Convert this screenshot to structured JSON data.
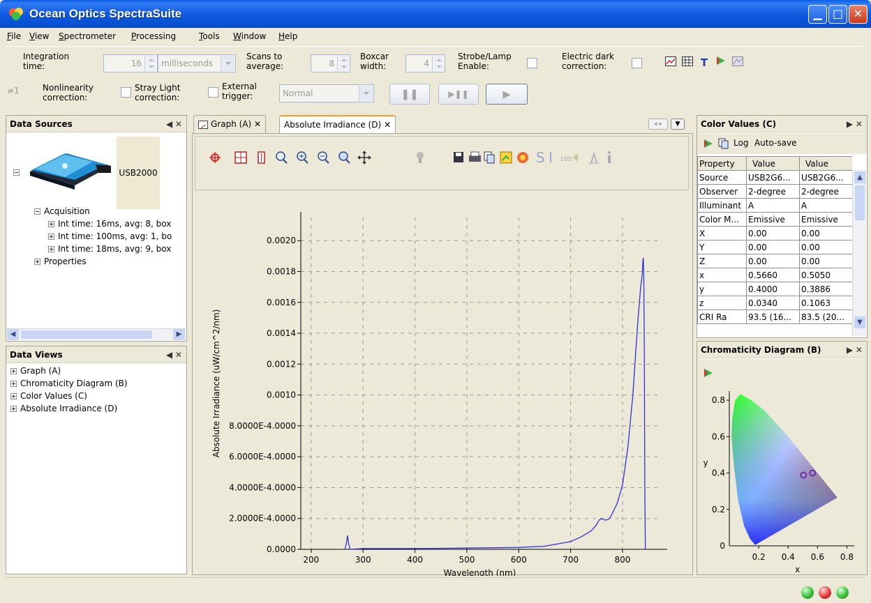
{
  "window": {
    "title": "Ocean Optics SpectraSuite"
  },
  "menu": [
    "File",
    "View",
    "Spectrometer",
    "Processing",
    "Tools",
    "Window",
    "Help"
  ],
  "toolbar": {
    "integration_time_label": "Integration time:",
    "integration_time_value": "16",
    "integration_unit": "milliseconds",
    "scans_label": "Scans to average:",
    "scans_value": "8",
    "boxcar_label": "Boxcar width:",
    "boxcar_value": "4",
    "strobe_label": "Strobe/Lamp Enable:",
    "dark_label": "Electric dark correction:",
    "nonlinearity_label": "Nonlinearity correction:",
    "stray_label": "Stray Light correction:",
    "trigger_label": "External trigger:",
    "trigger_value": "Normal",
    "neq_symbol": "≠1"
  },
  "data_sources": {
    "title": "Data Sources",
    "device": "USB2000",
    "acquisition_label": "Acquisition",
    "items": [
      "Int time: 16ms, avg: 8, box",
      "Int time: 100ms, avg: 1, bo",
      "Int time: 18ms, avg: 9, box"
    ],
    "properties_label": "Properties"
  },
  "data_views": {
    "title": "Data Views",
    "items": [
      "Graph (A)",
      "Chromaticity Diagram (B)",
      "Color Values (C)",
      "Absolute Irradiance (D)"
    ]
  },
  "tabs": [
    {
      "label": "Graph (A)",
      "active": false
    },
    {
      "label": "Absolute Irradiance (D)",
      "active": true
    }
  ],
  "chart_data": [
    {
      "type": "line",
      "title": "",
      "xlabel": "Wavelength (nm)",
      "ylabel": "Absolute Irradiance (uW/cm^2/nm)",
      "xlim": [
        180,
        870
      ],
      "ylim": [
        0,
        0.00215
      ],
      "xticks": [
        200,
        300,
        400,
        500,
        600,
        700,
        800
      ],
      "yticks": [
        0,
        0.0002,
        0.0004,
        0.0006,
        0.0008,
        0.001,
        0.0012,
        0.0014,
        0.0016,
        0.0018,
        0.002
      ],
      "ytick_labels": [
        "0.0000",
        "2.0000E-4.0000",
        "4.0000E-4.0000",
        "6.0000E-4.0000",
        "8.0000E-4.0000",
        "0.0010",
        "0.0012",
        "0.0014",
        "0.0016",
        "0.0018",
        "0.0020"
      ],
      "grid": true,
      "series": [
        {
          "color": "#3030d8",
          "x": [
            265,
            268,
            270,
            272,
            275,
            300,
            400,
            500,
            600,
            650,
            700,
            720,
            740,
            750,
            755,
            760,
            765,
            770,
            775,
            780,
            790,
            800,
            810,
            820,
            825,
            830,
            835,
            838,
            839,
            840,
            841,
            842,
            843,
            844
          ],
          "y": [
            0,
            4e-05,
            9e-05,
            4e-05,
            0,
            5e-06,
            5e-06,
            8e-06,
            1.2e-05,
            2e-05,
            5e-05,
            8e-05,
            0.00012,
            0.00016,
            0.00019,
            0.0002,
            0.00019,
            0.00019,
            0.0002,
            0.00023,
            0.0003,
            0.00042,
            0.00065,
            0.001,
            0.00125,
            0.0015,
            0.0017,
            0.00178,
            0.00186,
            0.00189,
            0.0018,
            0.0013,
            0.0004,
            0
          ]
        }
      ]
    },
    {
      "type": "scatter",
      "title": "",
      "xlabel": "x",
      "ylabel": "y",
      "xlim": [
        0,
        0.85
      ],
      "ylim": [
        0,
        0.85
      ],
      "xticks": [
        0.2,
        0.4,
        0.6,
        0.8
      ],
      "yticks": [
        0.2,
        0.4,
        0.6,
        0.8
      ],
      "series": [
        {
          "x": [
            0.566,
            0.505
          ],
          "y": [
            0.4,
            0.3886
          ]
        }
      ]
    }
  ],
  "color_values": {
    "title": "Color Values (C)",
    "log_label": "Log",
    "autosave_label": "Auto-save",
    "headers": [
      "Property",
      "Value",
      "Value"
    ],
    "rows": [
      [
        "Source",
        "USB2G6...",
        "USB2G6..."
      ],
      [
        "Observer",
        "2-degree",
        "2-degree"
      ],
      [
        "Illuminant",
        "A",
        "A"
      ],
      [
        "Color M...",
        "Emissive",
        "Emissive"
      ],
      [
        "X",
        "0.00",
        "0.00"
      ],
      [
        "Y",
        "0.00",
        "0.00"
      ],
      [
        "Z",
        "0.00",
        "0.00"
      ],
      [
        "x",
        "0.5660",
        "0.5050"
      ],
      [
        "y",
        "0.4000",
        "0.3886"
      ],
      [
        "z",
        "0.0340",
        "0.1063"
      ],
      [
        "CRI Ra",
        "93.5 (16...",
        "83.5 (20..."
      ]
    ]
  },
  "chromaticity": {
    "title": "Chromaticity Diagram (B)"
  }
}
